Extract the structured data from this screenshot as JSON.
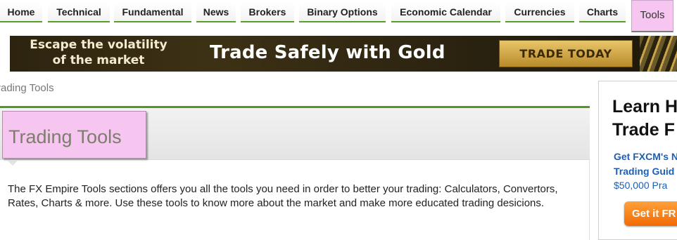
{
  "nav": {
    "items": [
      {
        "label": "Home"
      },
      {
        "label": "Technical"
      },
      {
        "label": "Fundamental"
      },
      {
        "label": "News"
      },
      {
        "label": "Brokers"
      },
      {
        "label": "Binary Options"
      },
      {
        "label": "Economic Calendar"
      },
      {
        "label": "Currencies"
      },
      {
        "label": "Charts"
      },
      {
        "label": "Tools",
        "active": true
      }
    ]
  },
  "banner": {
    "left_line1": "Escape the volatility",
    "left_line2": "of the market",
    "headline": "Trade Safely with Gold",
    "cta": "TRADE TODAY"
  },
  "breadcrumb": "rading Tools",
  "main": {
    "title": "Trading Tools",
    "intro": "The FX Empire Tools sections offers you all the tools you need in order to better your trading: Calculators, Convertors, Rates, Charts & more. Use these tools to know more about the market and make more educated trading desicions."
  },
  "ad": {
    "headline_line1": "Learn H",
    "headline_line2": "Trade F",
    "blue_line1": "Get FXCM's N",
    "blue_line2": "Trading Guid",
    "amount": "$50,000 Pra",
    "cta": "Get it FR"
  },
  "colors": {
    "nav_underline": "#5a9e2a",
    "active_tab": "#f6c6f0",
    "panel_accent": "#4e9a1e",
    "ad_link": "#1d5fb5",
    "ad_button": "#f26a06"
  }
}
